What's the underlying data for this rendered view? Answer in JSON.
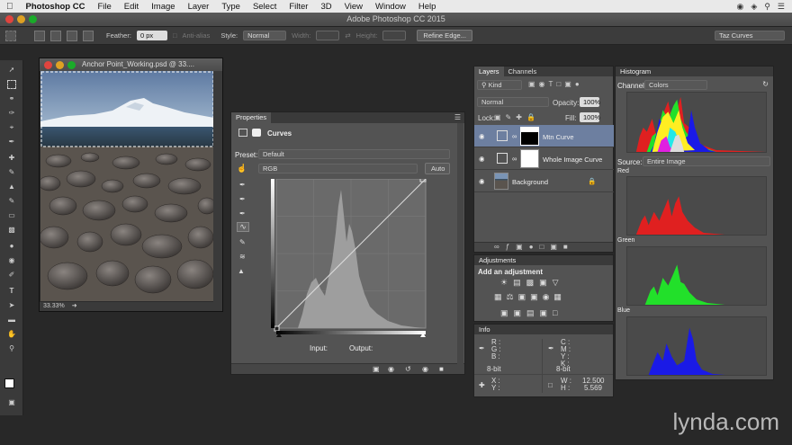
{
  "menubar": {
    "app": "Photoshop CC",
    "items": [
      "File",
      "Edit",
      "Image",
      "Layer",
      "Type",
      "Select",
      "Filter",
      "3D",
      "View",
      "Window",
      "Help"
    ]
  },
  "titlebar": {
    "title": "Adobe Photoshop CC 2015"
  },
  "options": {
    "feather_label": "Feather:",
    "feather_value": "0 px",
    "antialias_label": "Anti-alias",
    "style_label": "Style:",
    "style_value": "Normal",
    "width_label": "Width:",
    "height_label": "Height:",
    "refine_edge": "Refine Edge...",
    "workspace": "Taz Curves"
  },
  "document": {
    "title": "Anchor Point_Working.psd @ 33....",
    "zoom": "33.33%"
  },
  "properties": {
    "tab": "Properties",
    "panel_title": "Curves",
    "preset_label": "Preset:",
    "preset_value": "Default",
    "channel_value": "RGB",
    "auto_button": "Auto",
    "input_label": "Input:",
    "output_label": "Output:"
  },
  "layers": {
    "tabs": [
      "Layers",
      "Channels"
    ],
    "filter": "Kind",
    "blend_mode": "Normal",
    "opacity_label": "Opacity:",
    "opacity_value": "100%",
    "lock_label": "Lock:",
    "fill_label": "Fill:",
    "fill_value": "100%",
    "rows": [
      {
        "name": "Mtn Curve"
      },
      {
        "name": "Whole Image Curve"
      },
      {
        "name": "Background"
      }
    ]
  },
  "adjustments": {
    "tab": "Adjustments",
    "heading": "Add an adjustment"
  },
  "info": {
    "tab": "Info",
    "rgb_labels": [
      "R :",
      "G :",
      "B :"
    ],
    "cmyk_labels": [
      "C :",
      "M :",
      "Y :",
      "K :"
    ],
    "bitdepth_left": "8-bit",
    "bitdepth_right": "8-bit",
    "x_label": "X :",
    "y_label": "Y :",
    "w_label": "W :",
    "h_label": "H :",
    "w_value": "12.500",
    "h_value": "5.569"
  },
  "histogram": {
    "tab": "Histogram",
    "channel_label": "Channel:",
    "channel_value": "Colors",
    "source_label": "Source:",
    "source_value": "Entire Image",
    "red_label": "Red",
    "green_label": "Green",
    "blue_label": "Blue"
  },
  "watermark": {
    "text": "lynda.com"
  },
  "colors": {
    "red": "#e02020",
    "green": "#22e02a",
    "blue": "#1a1ae6",
    "panel": "#535353",
    "accent": "#ffffff"
  }
}
